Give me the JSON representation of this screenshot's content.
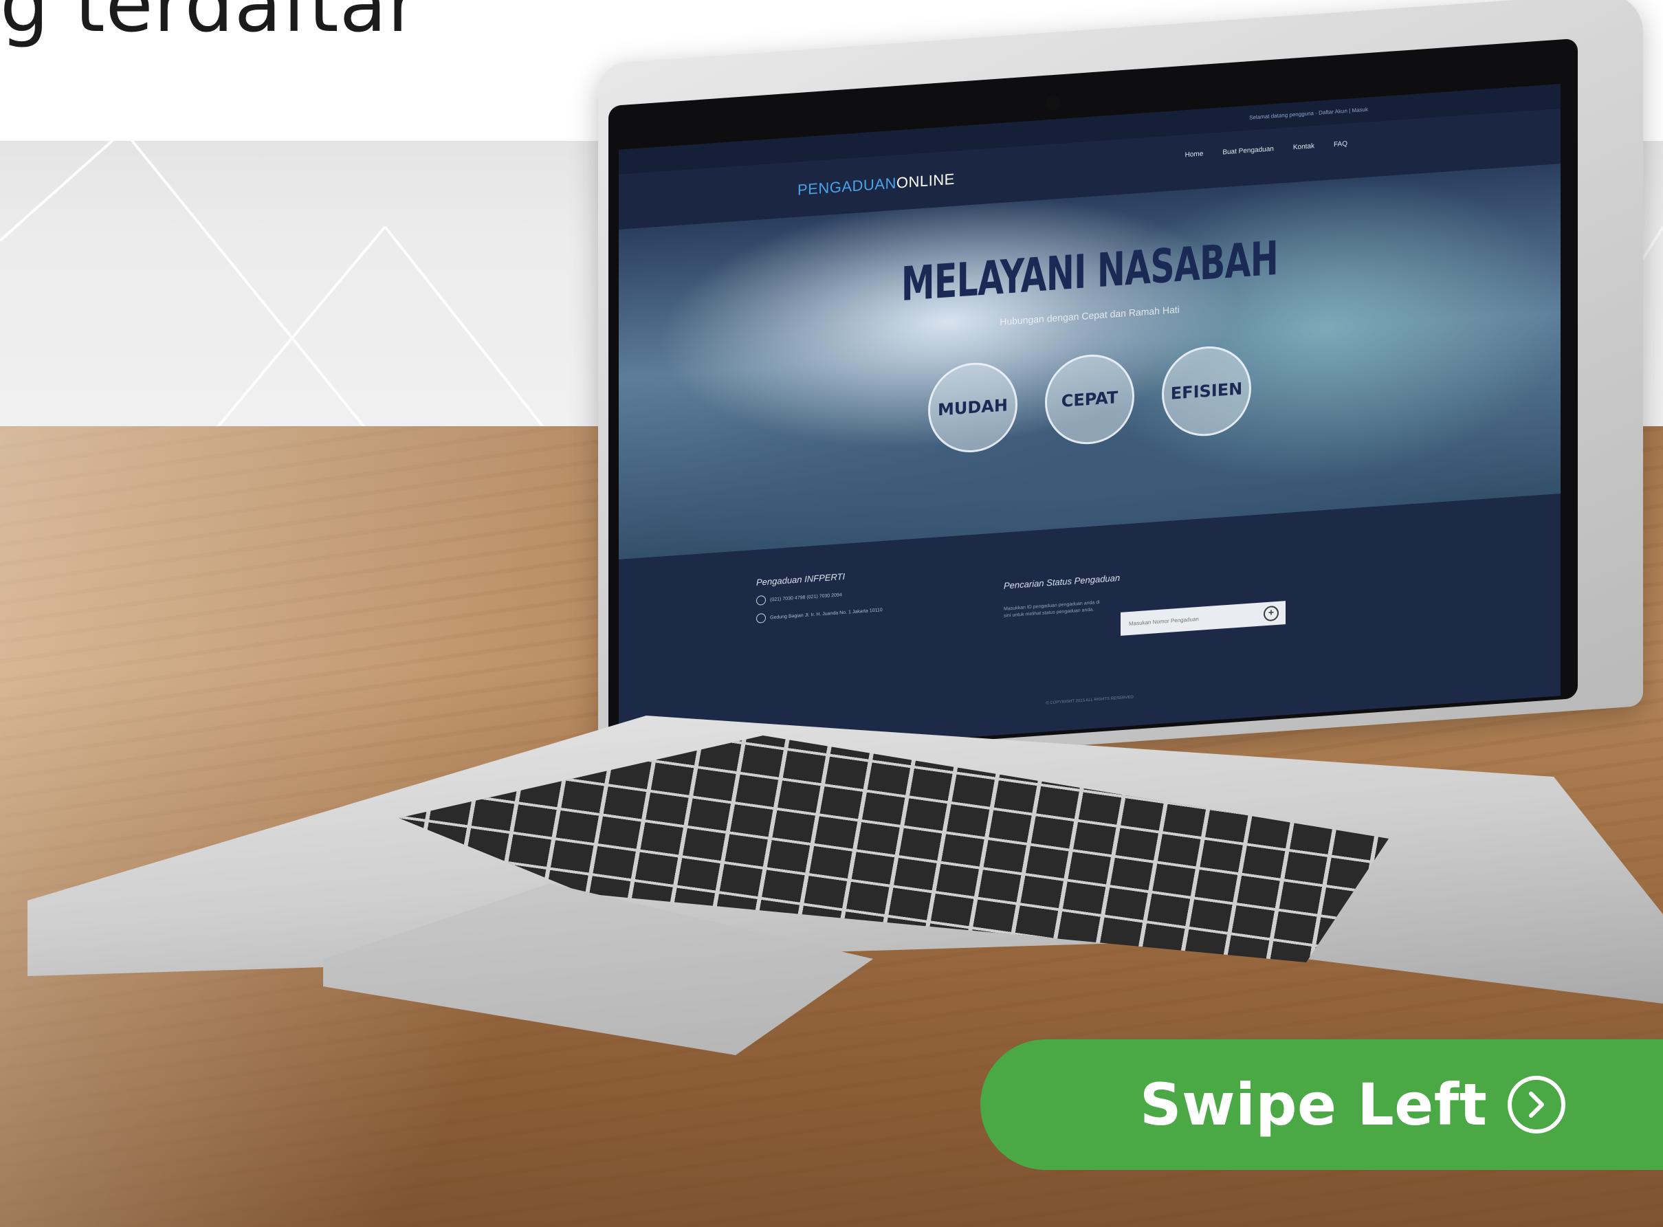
{
  "headline": "g terdaftar",
  "screen": {
    "topbar_text": "Selamat datang pengguna · Daftar Akun | Masuk",
    "logo_part1": "PENGADUAN",
    "logo_part2": "ONLINE",
    "menu": [
      {
        "label": "Home"
      },
      {
        "label": "Buat Pengaduan"
      },
      {
        "label": "Kontak"
      },
      {
        "label": "FAQ"
      }
    ],
    "hero_title": "MELAYANI NASABAH",
    "hero_subtitle": "Hubungan dengan Cepat dan Ramah Hati",
    "circles": [
      "MUDAH",
      "CEPAT",
      "EFISIEN"
    ],
    "footer": {
      "col1_title": "Pengaduan INFPERTI",
      "phone": "(021) 7030 4798 (021) 7030 2094",
      "address": "Gedung Bagian Jl. Ir. H. Juanda No. 1 Jakarta 10110",
      "col2_title": "Pencarian Status Pengaduan",
      "col2_desc": "Masukkan ID pengaduan pengaduan anda di sini untuk melihat status pengaduan anda.",
      "search_placeholder": "Masukan Nomor Pengaduan",
      "copyright": "© COPYRIGHT 2015 ALL RIGHTS RESERVED"
    }
  },
  "swipe_button": {
    "label": "Swipe Left",
    "icon": "chevron-right-circle-icon",
    "color": "#4aa845"
  }
}
